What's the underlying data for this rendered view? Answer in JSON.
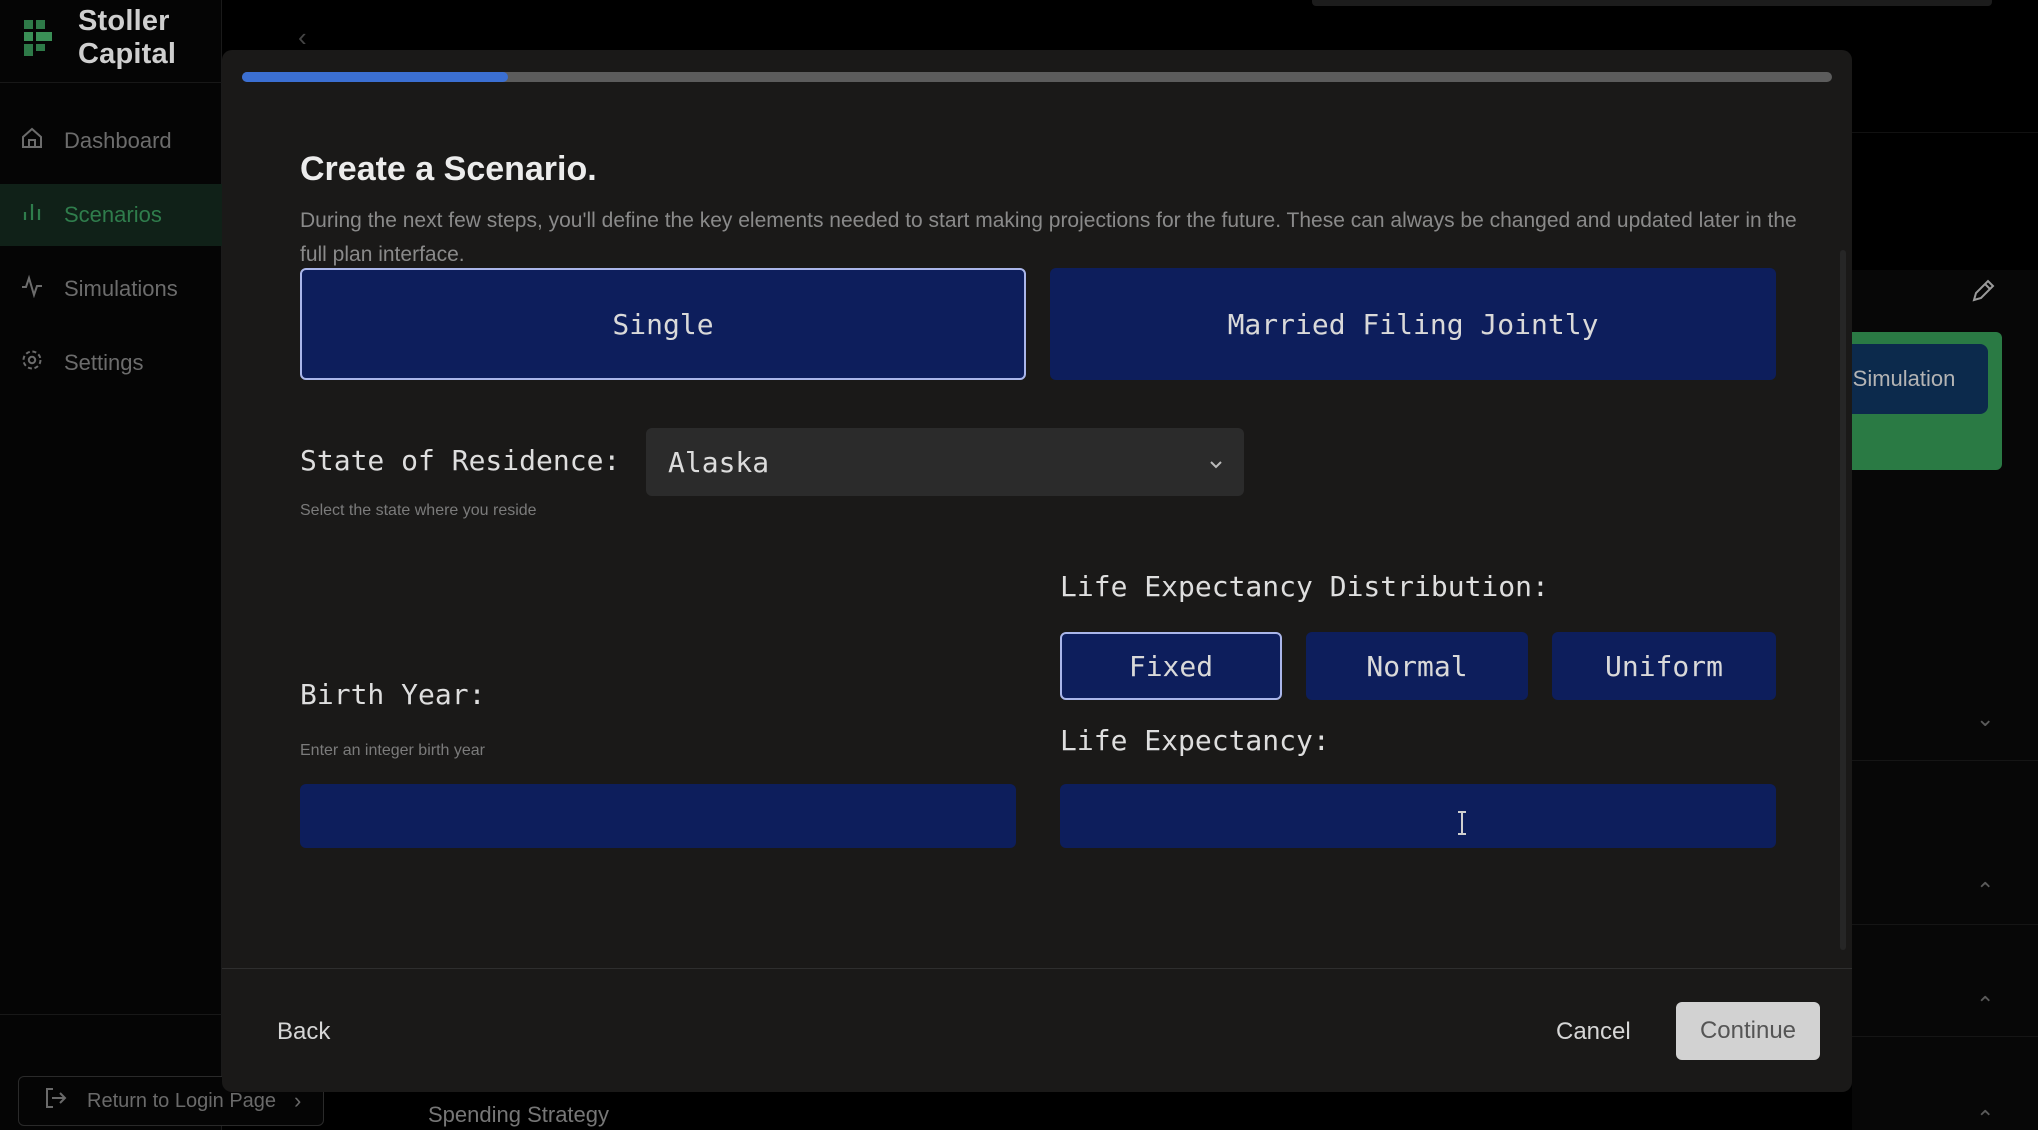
{
  "app": {
    "name": "Stoller Capital"
  },
  "sidebar": {
    "items": [
      {
        "label": "Dashboard",
        "icon": "home-icon"
      },
      {
        "label": "Scenarios",
        "icon": "bar-chart-icon",
        "active": true
      },
      {
        "label": "Simulations",
        "icon": "activity-icon"
      },
      {
        "label": "Settings",
        "icon": "gear-icon"
      }
    ],
    "return_label": "Return to Login Page"
  },
  "background": {
    "simulation_button": "Simulation",
    "spending_strategy": "Spending Strategy"
  },
  "modal": {
    "progress_fraction": 0.167,
    "title": "Create a Scenario.",
    "description": "During the next few steps, you'll define the key elements needed to start making projections for the future. These can always be changed and updated later in the full plan interface.",
    "filing_status": {
      "options": [
        "Single",
        "Married Filing Jointly"
      ],
      "selected": "Single"
    },
    "state": {
      "label": "State of Residence:",
      "value": "Alaska",
      "hint": "Select the state where you reside"
    },
    "life_expectancy_distribution": {
      "label": "Life Expectancy Distribution:",
      "options": [
        "Fixed",
        "Normal",
        "Uniform"
      ],
      "selected": "Fixed"
    },
    "birth_year": {
      "label": "Birth Year:",
      "hint": "Enter an integer birth year",
      "value": ""
    },
    "life_expectancy": {
      "label": "Life Expectancy:",
      "value": ""
    },
    "footer": {
      "back": "Back",
      "cancel": "Cancel",
      "continue": "Continue"
    }
  },
  "colors": {
    "accent_blue": "#3b6fd2",
    "button_navy": "#0d1e5c",
    "active_green": "#2f7d4c",
    "modal_bg": "#1a1918"
  }
}
